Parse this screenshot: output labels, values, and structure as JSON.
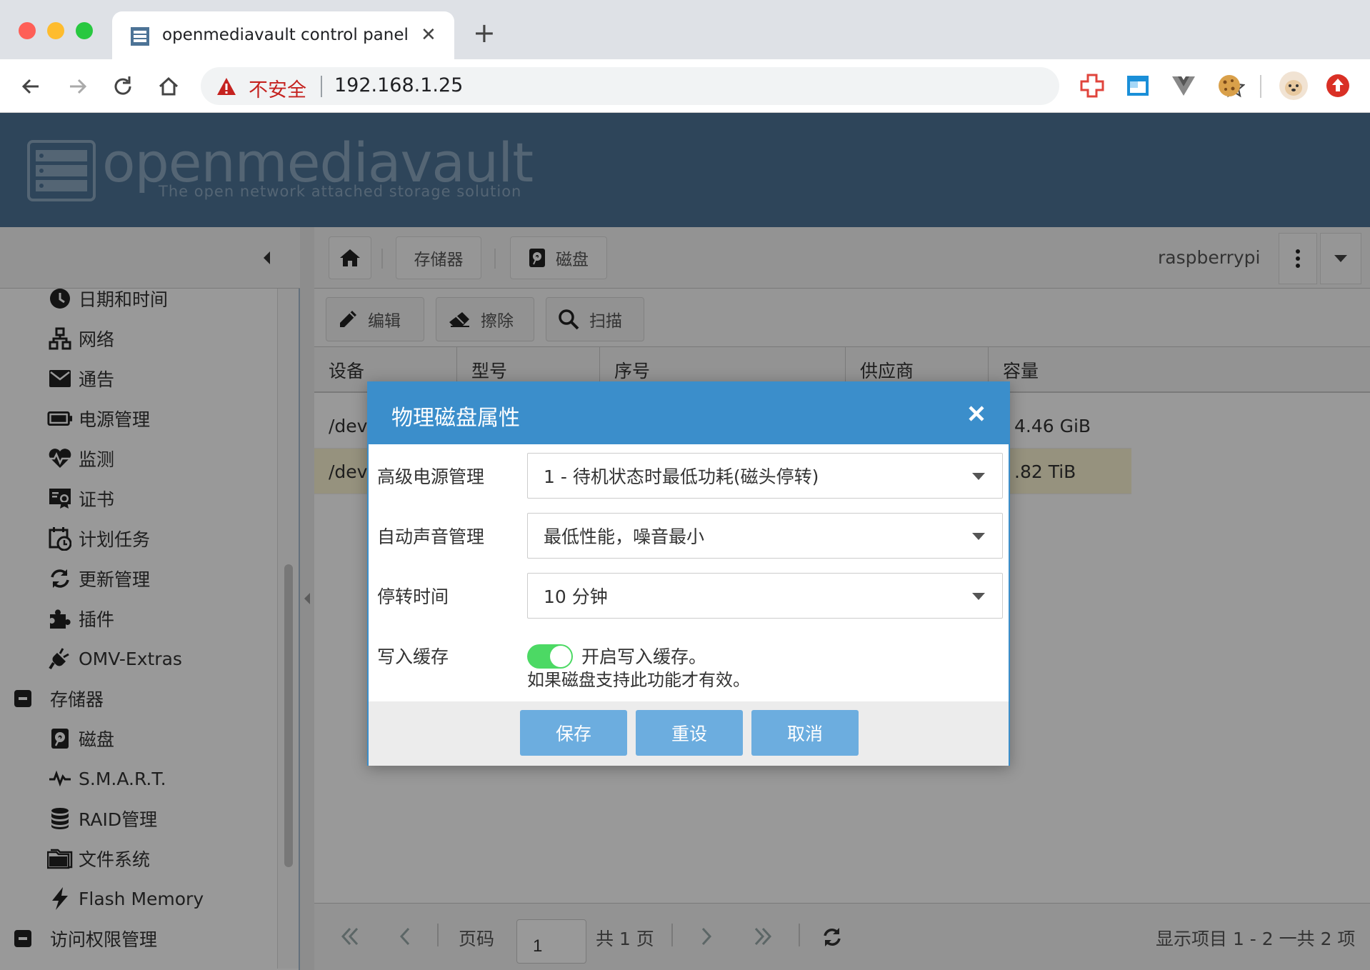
{
  "browser": {
    "tab_title": "openmediavault control panel - raspberrypi",
    "insecure_label": "不安全",
    "url": "192.168.1.25"
  },
  "header": {
    "logo_text": "openmediavault",
    "logo_subtitle": "The open network attached storage solution"
  },
  "sidebar": {
    "items": [
      {
        "label": "日期和时间",
        "icon": "clock-icon"
      },
      {
        "label": "网络",
        "icon": "network-icon"
      },
      {
        "label": "通告",
        "icon": "envelope-icon"
      },
      {
        "label": "电源管理",
        "icon": "battery-icon"
      },
      {
        "label": "监测",
        "icon": "heartbeat-icon"
      },
      {
        "label": "证书",
        "icon": "certificate-icon"
      },
      {
        "label": "计划任务",
        "icon": "calendar-clock-icon"
      },
      {
        "label": "更新管理",
        "icon": "refresh-icon"
      },
      {
        "label": "插件",
        "icon": "puzzle-icon"
      },
      {
        "label": "OMV-Extras",
        "icon": "plug-icon"
      }
    ],
    "group_storage": "存储器",
    "storage_items": [
      {
        "label": "磁盘",
        "icon": "disk-icon"
      },
      {
        "label": "S.M.A.R.T.",
        "icon": "pulse-icon"
      },
      {
        "label": "RAID管理",
        "icon": "database-icon"
      },
      {
        "label": "文件系统",
        "icon": "folder-icon"
      },
      {
        "label": "Flash Memory",
        "icon": "bolt-icon"
      }
    ],
    "group_access": "访问权限管理"
  },
  "breadcrumb": {
    "storage": "存储器",
    "disks": "磁盘",
    "hostname": "raspberrypi"
  },
  "actions": {
    "edit": "编辑",
    "wipe": "擦除",
    "scan": "扫描"
  },
  "grid": {
    "columns": [
      "设备",
      "型号",
      "序号",
      "供应商",
      "容量"
    ],
    "rows": [
      {
        "device": "/dev",
        "capacity": "4.46 GiB"
      },
      {
        "device": "/dev",
        "capacity": ".82 TiB"
      }
    ]
  },
  "pager": {
    "page_label": "页码",
    "page_value": "1",
    "total_pages": "共 1 页",
    "display_info": "显示项目 1 - 2 一共 2 项"
  },
  "dialog": {
    "title": "物理磁盘属性",
    "apm_label": "高级电源管理",
    "apm_value": "1 - 待机状态时最低功耗(磁头停转)",
    "aam_label": "自动声音管理",
    "aam_value": "最低性能，噪音最小",
    "spindown_label": "停转时间",
    "spindown_value": "10 分钟",
    "write_cache_label": "写入缓存",
    "write_cache_enabled": true,
    "write_cache_toggle_label": "开启写入缓存。",
    "write_cache_hint": "如果磁盘支持此功能才有效。",
    "save": "保存",
    "reset": "重设",
    "cancel": "取消"
  },
  "colors": {
    "header_bg": "#4d7396",
    "dialog_accent": "#3b8ecb",
    "button_bg": "#6caddf",
    "toggle_on": "#4cd964",
    "insecure_red": "#c5221f"
  }
}
